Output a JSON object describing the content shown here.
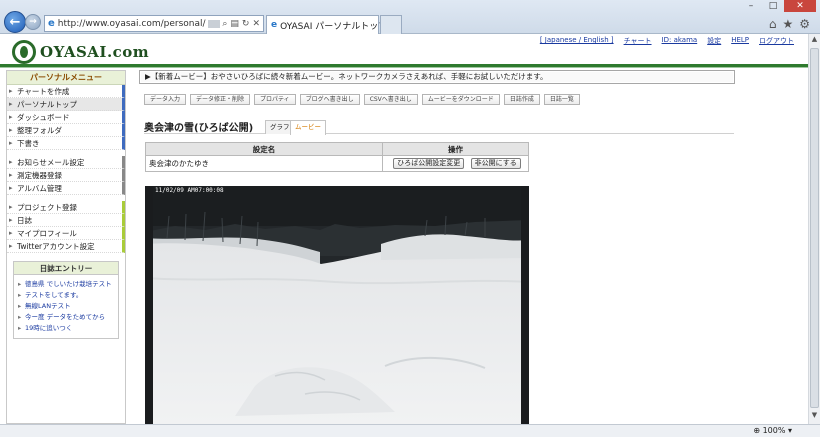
{
  "browser": {
    "url_prefix": "http://www.oyasai.com/personal/",
    "url_suffix": "",
    "tab_title": "OYASAI パーソナルトップ",
    "zoom": "100%"
  },
  "header": {
    "logo_text": "OYASAI.com",
    "links": [
      "[ Japanese / English ]",
      "チャート",
      "ID: akama",
      "設定",
      "HELP",
      "ログアウト"
    ]
  },
  "sidebar": {
    "title": "パーソナルメニュー",
    "group1": [
      "チャートを作成",
      "パーソナルトップ",
      "ダッシュボード",
      "整理フォルダ",
      "下書き"
    ],
    "group2": [
      "お知らせメール設定",
      "測定機器登録",
      "アルバム管理"
    ],
    "group3": [
      "プロジェクト登録",
      "日誌",
      "マイプロフィール",
      "Twitterアカウント設定"
    ],
    "active": "パーソナルトップ",
    "diary": {
      "title": "日誌エントリー",
      "items": [
        "徳島県 でしいたけ栽培テスト",
        "テストをしてます。",
        "無線LANテスト",
        "今ー度 データをためてから",
        "19時に追いつく"
      ]
    }
  },
  "main": {
    "news": "▶【新着ムービー】おやさいひろばに続々新着ムービー。ネットワークカメラさえあれば、手軽にお試しいただけます。",
    "actions": [
      "データ入力",
      "データ修正・削除",
      "プロパティ",
      "ブログへ書き出し",
      "CSVへ書き出し",
      "ムービーをダウンロード",
      "日誌作成",
      "日誌一覧"
    ],
    "title": "奥会津の雪(ひろば公開)",
    "tabs": [
      "グラフ",
      "ムービー"
    ],
    "settings": {
      "headers": [
        "設定名",
        "操作"
      ],
      "row_name": "奥会津のかたゆき",
      "buttons": [
        "ひろば公開設定変更",
        "非公開にする"
      ]
    },
    "camera_timestamp": "11/02/09 AM07:00:08"
  }
}
